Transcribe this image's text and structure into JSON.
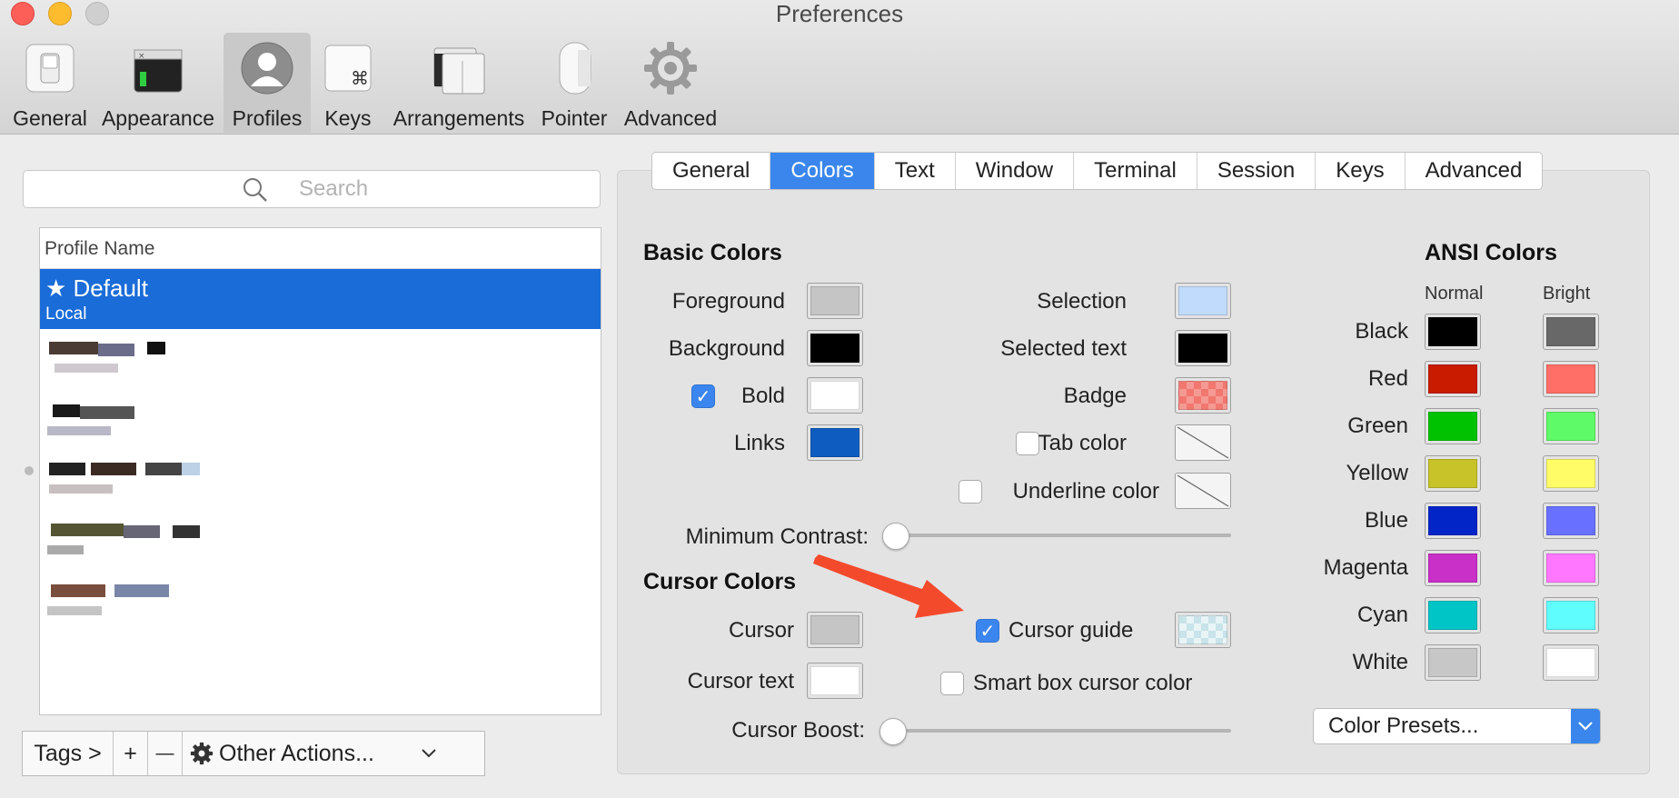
{
  "window": {
    "title": "Preferences"
  },
  "toolbar": {
    "items": [
      {
        "label": "General",
        "icon": "switch-icon"
      },
      {
        "label": "Appearance",
        "icon": "appearance-window-icon"
      },
      {
        "label": "Profiles",
        "icon": "profile-person-icon",
        "active": true
      },
      {
        "label": "Keys",
        "icon": "command-key-icon"
      },
      {
        "label": "Arrangements",
        "icon": "arrangements-windows-icon"
      },
      {
        "label": "Pointer",
        "icon": "mouse-icon"
      },
      {
        "label": "Advanced",
        "icon": "gear-icon"
      }
    ]
  },
  "sidebar": {
    "search_placeholder": "Search",
    "table_header": "Profile Name",
    "selected_profile": {
      "name": "★ Default",
      "meta": "Local"
    },
    "bottom_bar": {
      "tags": "Tags >",
      "add": "+",
      "remove": "—",
      "other_actions": "Other Actions..."
    }
  },
  "tabs": [
    "General",
    "Colors",
    "Text",
    "Window",
    "Terminal",
    "Session",
    "Keys",
    "Advanced"
  ],
  "active_tab": "Colors",
  "basic_colors": {
    "heading": "Basic Colors",
    "foreground": {
      "label": "Foreground",
      "color": "#c5c5c5"
    },
    "background": {
      "label": "Background",
      "color": "#000000"
    },
    "bold": {
      "label": "Bold",
      "color": "#ffffff",
      "checked": true
    },
    "links": {
      "label": "Links",
      "color": "#0e5cc0"
    },
    "selection": {
      "label": "Selection",
      "color": "#c1dbfd"
    },
    "selected_text": {
      "label": "Selected text",
      "color": "#000000"
    },
    "badge": {
      "label": "Badge",
      "color": "#f1776f"
    },
    "tab_color": {
      "label": "Tab color",
      "checked": false
    },
    "underline_color": {
      "label": "Underline color",
      "checked": false
    },
    "minimum_contrast": {
      "label": "Minimum Contrast:",
      "value": 0
    }
  },
  "cursor_colors": {
    "heading": "Cursor Colors",
    "cursor": {
      "label": "Cursor",
      "color": "#c5c5c5"
    },
    "cursor_text": {
      "label": "Cursor text",
      "color": "#ffffff"
    },
    "cursor_guide": {
      "label": "Cursor guide",
      "checked": true,
      "color": "#c8e3e9"
    },
    "smart_box": {
      "label": "Smart box cursor color",
      "checked": false
    },
    "cursor_boost": {
      "label": "Cursor Boost:",
      "value": 0
    }
  },
  "ansi_colors": {
    "heading": "ANSI Colors",
    "normal_header": "Normal",
    "bright_header": "Bright",
    "rows": [
      {
        "name": "Black",
        "normal": "#000000",
        "bright": "#686868"
      },
      {
        "name": "Red",
        "normal": "#c91b00",
        "bright": "#ff6e67"
      },
      {
        "name": "Green",
        "normal": "#00c200",
        "bright": "#5ffa68"
      },
      {
        "name": "Yellow",
        "normal": "#c7c329",
        "bright": "#fffc67"
      },
      {
        "name": "Blue",
        "normal": "#0225c7",
        "bright": "#6871ff"
      },
      {
        "name": "Magenta",
        "normal": "#c930c7",
        "bright": "#ff77ff"
      },
      {
        "name": "Cyan",
        "normal": "#00c5c7",
        "bright": "#60fdff"
      },
      {
        "name": "White",
        "normal": "#c7c7c7",
        "bright": "#ffffff"
      }
    ],
    "presets_label": "Color Presets..."
  },
  "accent": "#3a86ec",
  "annotation_arrow_color": "#f44a2c"
}
